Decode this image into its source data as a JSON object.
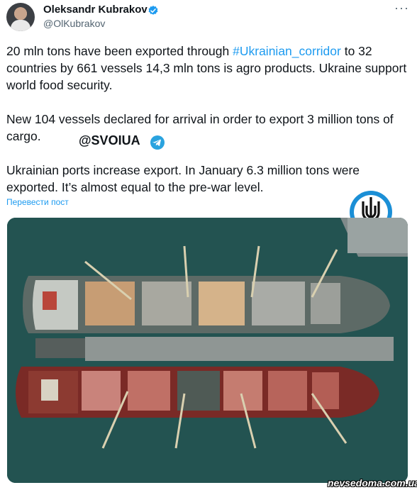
{
  "author": {
    "name": "Oleksandr Kubrakov",
    "handle": "@OlKubrakov"
  },
  "tweet": {
    "p1_before": "20 mln tons have been exported through ",
    "hashtag": "#Ukrainian_corridor",
    "p1_after": " to 32 countries by 661 vessels 14,3 mln tons is agro products. Ukraine support world food security.",
    "p2": "New 104 vessels declared for arrival in order to export 3 million tons of cargo.",
    "p3": "Ukrainian ports increase export. In January 6.3 million tons were exported. It’s  almost equal to the pre-war level."
  },
  "overlay_handle": "@SVOIUA",
  "translate_link": "Перевести пост",
  "watermark": "nevsedoma.com.ua",
  "icons": [
    "verified-icon",
    "more-icon",
    "telegram-icon",
    "trident-emblem-icon"
  ],
  "colors": {
    "link": "#1d9bf0",
    "sea": "#1f4f4e",
    "hull_red": "#7a2a26",
    "text": "#0f1419",
    "muted": "#536471"
  }
}
